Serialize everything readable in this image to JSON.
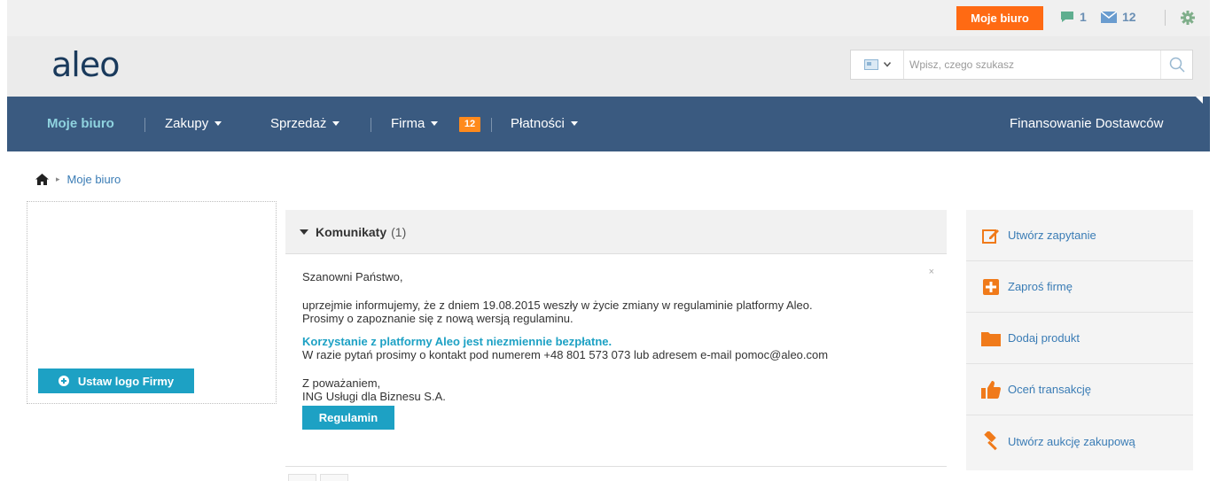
{
  "topbar": {
    "my_office_label": "Moje biuro",
    "chat_count": "1",
    "mail_count": "12"
  },
  "header": {
    "logo_text": "aleo",
    "search_placeholder": "Wpisz, czego szukasz"
  },
  "nav": {
    "items": [
      {
        "label": "Moje biuro"
      },
      {
        "label": "Zakupy"
      },
      {
        "label": "Sprzedaż"
      },
      {
        "label": "Firma"
      },
      {
        "label": "Płatności"
      }
    ],
    "company_badge": "12",
    "right_label": "Finansowanie Dostawców"
  },
  "breadcrumb": {
    "current": "Moje biuro"
  },
  "logo_box": {
    "button_label": "Ustaw logo Firmy"
  },
  "messages": {
    "title": "Komunikaty",
    "count": "(1)",
    "close_label": "×",
    "greeting": "Szanowni Państwo,",
    "line1": "uprzejmie informujemy, że z dniem 19.08.2015 weszły w życie zmiany w regulaminie platformy Aleo.",
    "line2": "Prosimy o zapoznanie się z nową wersją regulaminu.",
    "highlight": "Korzystanie z platformy Aleo jest niezmiennie bezpłatne.",
    "contact": "W razie pytań prosimy o kontakt pod numerem +48 801 573 073 lub adresem e-mail pomoc@aleo.com",
    "closing": "Z poważaniem,",
    "signature": "ING Usługi dla Biznesu S.A.",
    "button_label": "Regulamin"
  },
  "actions": {
    "items": [
      {
        "label": "Utwórz zapytanie",
        "icon": "edit-icon"
      },
      {
        "label": "Zaproś firmę",
        "icon": "plus-square-icon"
      },
      {
        "label": "Dodaj produkt",
        "icon": "folder-icon"
      },
      {
        "label": "Oceń transakcję",
        "icon": "thumbs-up-icon"
      },
      {
        "label": "Utwórz aukcję zakupową",
        "icon": "gavel-icon"
      }
    ]
  },
  "colors": {
    "accent_orange": "#ff6a13",
    "nav_blue": "#3a5a80",
    "teal": "#1da1c4",
    "link_blue": "#3a7cb5"
  }
}
